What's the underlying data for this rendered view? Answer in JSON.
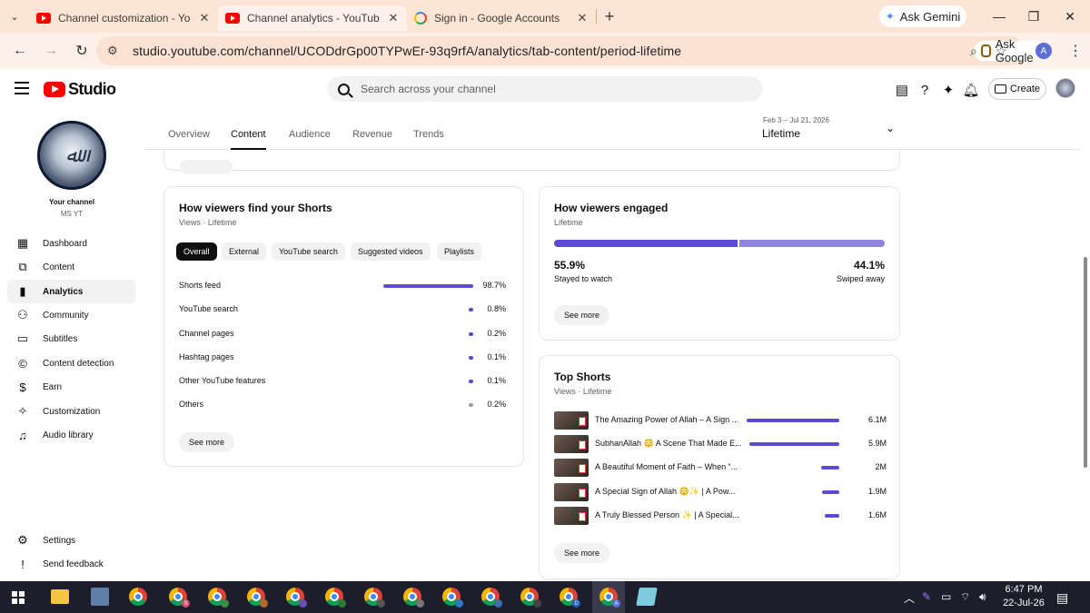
{
  "browser": {
    "tabs": [
      {
        "title": "Channel customization - YouTube",
        "icon": "youtube-favicon"
      },
      {
        "title": "Channel analytics - YouTube Studio",
        "icon": "youtube-favicon"
      },
      {
        "title": "Sign in - Google Accounts",
        "icon": "google-favicon"
      }
    ],
    "ask_gemini": "Ask Gemini",
    "url": "studio.youtube.com/channel/UCODdrGp00TYPwEr-93q9rfA/analytics/tab-content/period-lifetime",
    "ask_google": "Ask Google",
    "profile_initial": "A"
  },
  "studio": {
    "logo_text": "Studio",
    "search_placeholder": "Search across your channel",
    "create_label": "Create"
  },
  "sidebar": {
    "your_channel": "Your channel",
    "channel_name": "MS YT",
    "items": [
      {
        "label": "Dashboard",
        "icon": "dashboard-icon"
      },
      {
        "label": "Content",
        "icon": "content-icon"
      },
      {
        "label": "Analytics",
        "icon": "analytics-icon"
      },
      {
        "label": "Community",
        "icon": "community-icon"
      },
      {
        "label": "Subtitles",
        "icon": "subtitles-icon"
      },
      {
        "label": "Content detection",
        "icon": "copyright-icon"
      },
      {
        "label": "Earn",
        "icon": "dollar-icon"
      },
      {
        "label": "Customization",
        "icon": "magic-wand-icon"
      },
      {
        "label": "Audio library",
        "icon": "audio-library-icon"
      }
    ],
    "footer_items": [
      {
        "label": "Settings",
        "icon": "gear-icon"
      },
      {
        "label": "Send feedback",
        "icon": "feedback-icon"
      }
    ]
  },
  "analytics": {
    "tabs": [
      "Overview",
      "Content",
      "Audience",
      "Revenue",
      "Trends"
    ],
    "active_tab": "Content",
    "date_range": "Feb 3 – Jul 21, 2026",
    "period": "Lifetime"
  },
  "traffic": {
    "title": "How viewers find your Shorts",
    "subtitle": "Views · Lifetime",
    "chips": [
      "Overall",
      "External",
      "YouTube search",
      "Suggested videos",
      "Playlists"
    ],
    "active_chip": "Overall",
    "sources": [
      {
        "name": "Shorts feed",
        "pct": "98.7%",
        "value": 98.7
      },
      {
        "name": "YouTube search",
        "pct": "0.8%",
        "value": 0.8
      },
      {
        "name": "Channel pages",
        "pct": "0.2%",
        "value": 0.2
      },
      {
        "name": "Hashtag pages",
        "pct": "0.1%",
        "value": 0.1
      },
      {
        "name": "Other YouTube features",
        "pct": "0.1%",
        "value": 0.1
      },
      {
        "name": "Others",
        "pct": "0.2%",
        "value": 0.2
      }
    ],
    "see_more": "See more"
  },
  "engagement": {
    "title": "How viewers engaged",
    "subtitle": "Lifetime",
    "stayed_pct": "55.9%",
    "stayed_value": 55.9,
    "stayed_label": "Stayed to watch",
    "swiped_pct": "44.1%",
    "swiped_value": 44.1,
    "swiped_label": "Swiped away",
    "see_more": "See more"
  },
  "top_shorts": {
    "title": "Top Shorts",
    "subtitle": "Views · Lifetime",
    "items": [
      {
        "title": "The Amazing Power of Allah – A Sign ...",
        "views": "6.1M",
        "value": 6.1
      },
      {
        "title": "SubhanAllah 😳 A Scene That Made E...",
        "views": "5.9M",
        "value": 5.9
      },
      {
        "title": "A Beautiful Moment of Faith – When “...",
        "views": "2M",
        "value": 2.0
      },
      {
        "title": "A Special Sign of Allah 😳✨ | A Pow...",
        "views": "1.9M",
        "value": 1.9
      },
      {
        "title": "A Truly Blessed Person ✨ | A Special...",
        "views": "1.6M",
        "value": 1.6
      }
    ],
    "see_more": "See more"
  },
  "taskbar": {
    "time": "6:47 PM",
    "date": "22-Jul-26"
  }
}
